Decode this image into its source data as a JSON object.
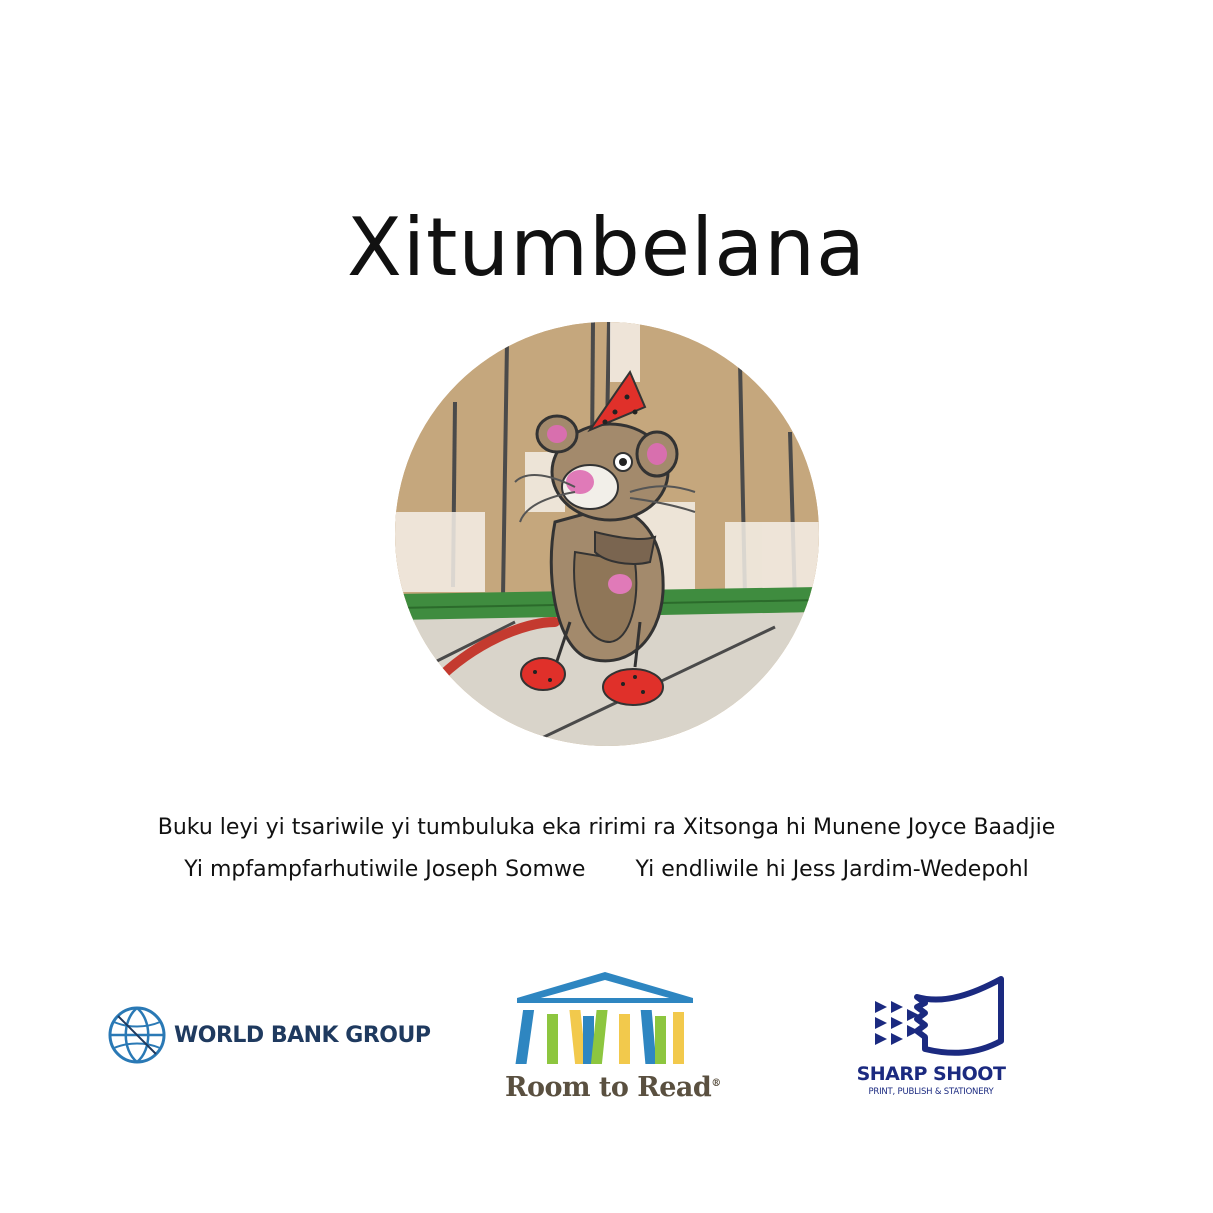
{
  "book": {
    "title": "Xitumbelana"
  },
  "credits": {
    "written_by": "Buku leyi yi tsariwile yi tumbuluka eka ririmi ra Xitsonga hi Munene Joyce Baadjie",
    "illustrated_by": "Yi mpfampfarhutiwile Joseph Somwe",
    "translated_by": "Yi endliwile hi Jess Jardim-Wedepohl"
  },
  "logos": {
    "world_bank": {
      "name": "WORLD BANK GROUP",
      "icon": "globe-icon",
      "color": "#1f3a5f"
    },
    "room_to_read": {
      "name": "Room to Read",
      "mark": "®",
      "icon": "bookshelf-icon",
      "color": "#5a5040"
    },
    "sharp_shoot": {
      "name": "SHARP SHOOT",
      "tagline": "PRINT, PUBLISH & STATIONERY",
      "icon": "sharp-shoot-icon",
      "color": "#1b2a80"
    }
  },
  "illustration": {
    "subject": "mouse-illustration"
  }
}
